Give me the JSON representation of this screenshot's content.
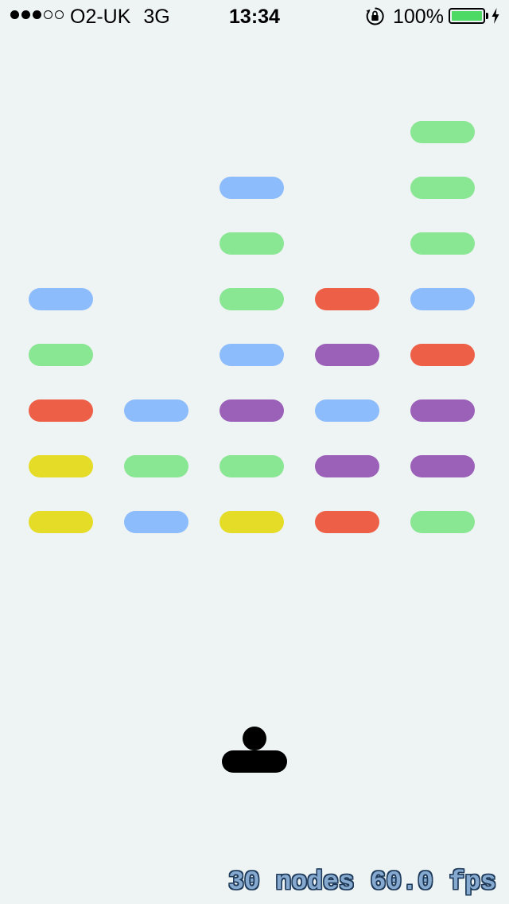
{
  "status_bar": {
    "signal_bars_filled": 3,
    "signal_bars_total": 5,
    "carrier": "O2-UK",
    "network": "3G",
    "time": "13:34",
    "battery_percent": "100%",
    "battery_level": 1.0,
    "charging": true,
    "icons": [
      "rotation-lock-icon",
      "battery-icon",
      "charging-bolt-icon"
    ]
  },
  "colors": {
    "background": "#eef3f3",
    "blue": "#8dbcfd",
    "green": "#89e693",
    "red": "#ee5f48",
    "purple": "#9b61b8",
    "yellow": "#e5dc27",
    "ball": "#000000",
    "paddle": "#000000",
    "battery_fill": "#4cd964"
  },
  "game": {
    "grid_columns": 5,
    "grid_rows": 8,
    "bricks_by_column": [
      [
        null,
        null,
        null,
        "blue",
        "green",
        "red",
        "yellow",
        "yellow"
      ],
      [
        null,
        null,
        null,
        null,
        null,
        "blue",
        "green",
        "blue"
      ],
      [
        null,
        "blue",
        "green",
        "green",
        "blue",
        "purple",
        "green",
        "yellow"
      ],
      [
        null,
        null,
        null,
        "red",
        "purple",
        "blue",
        "purple",
        "red"
      ],
      [
        "green",
        "green",
        "green",
        "blue",
        "red",
        "purple",
        "purple",
        "green"
      ]
    ]
  },
  "debug": {
    "nodes": "30 nodes",
    "fps": "60.0 fps"
  }
}
